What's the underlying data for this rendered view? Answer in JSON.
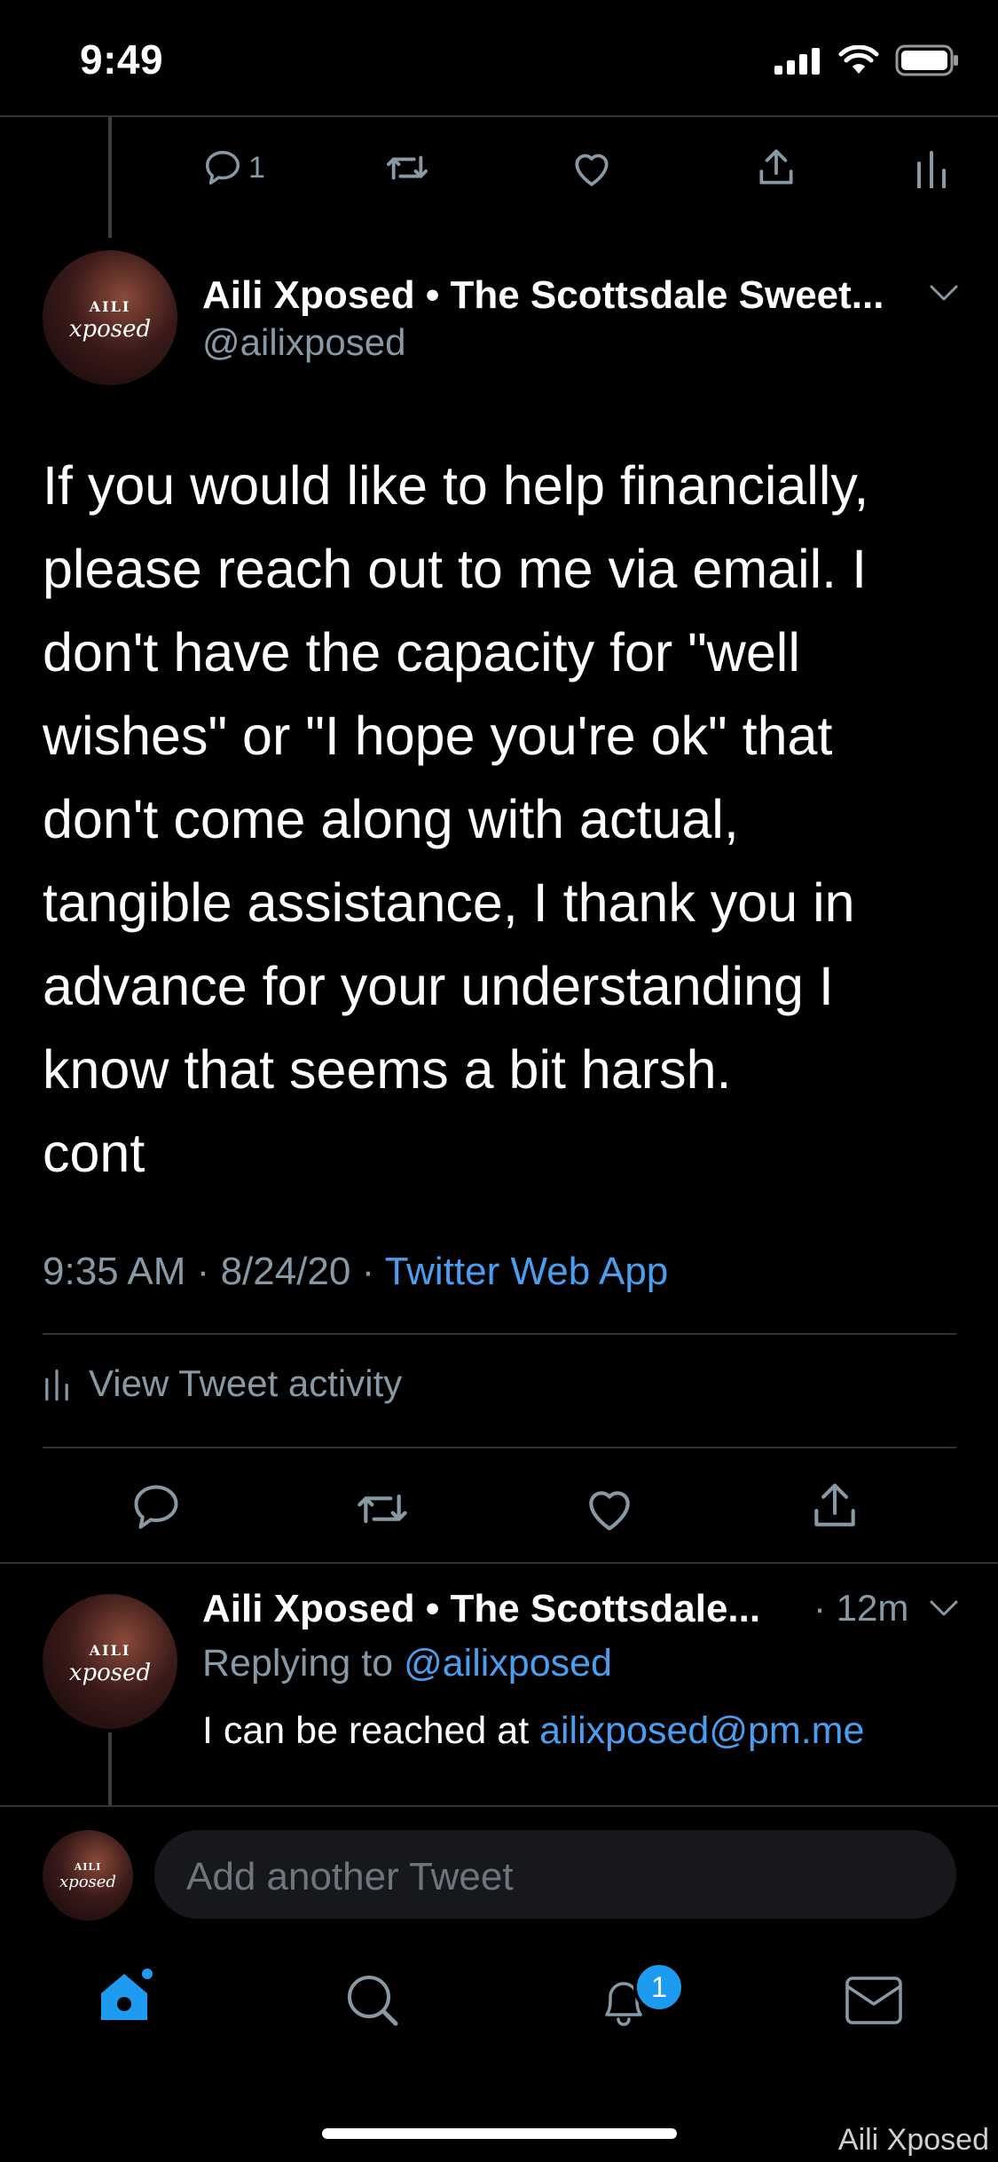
{
  "status_bar": {
    "time": "9:49"
  },
  "top_actions": {
    "reply_count": "1"
  },
  "tweet": {
    "display_name": "Aili Xposed • The Scottsdale Sweet...",
    "handle": "@ailixposed",
    "avatar_text_line1": "AILI",
    "avatar_text_line2": "xposed",
    "text": "If you would like to help financially,\nplease reach out to me via email. I\ndon't have the capacity for \"well\nwishes\" or \"I hope you're ok\" that\ndon't come along with actual,\ntangible assistance, I thank you in\nadvance for your understanding I\nknow that seems a bit harsh.\ncont",
    "time": "9:35 AM",
    "sep1": "·",
    "date": "8/24/20",
    "sep2": "·",
    "source": "Twitter Web App",
    "activity_label": "View Tweet activity"
  },
  "reply": {
    "display_name": "Aili Xposed • The Scottsdale...",
    "time": "· 12m",
    "replying_prefix": "Replying to ",
    "replying_handle": "@ailixposed",
    "text_prefix": "I can be reached at ",
    "email": "ailixposed@pm.me"
  },
  "composer": {
    "placeholder": "Add another Tweet"
  },
  "tab_bar": {
    "notifications_badge": "1"
  },
  "watermark": "Aili Xposed",
  "colors": {
    "background": "#000000",
    "accent": "#1d9bf0",
    "link": "#4a9ef0",
    "muted": "#8899a6"
  }
}
